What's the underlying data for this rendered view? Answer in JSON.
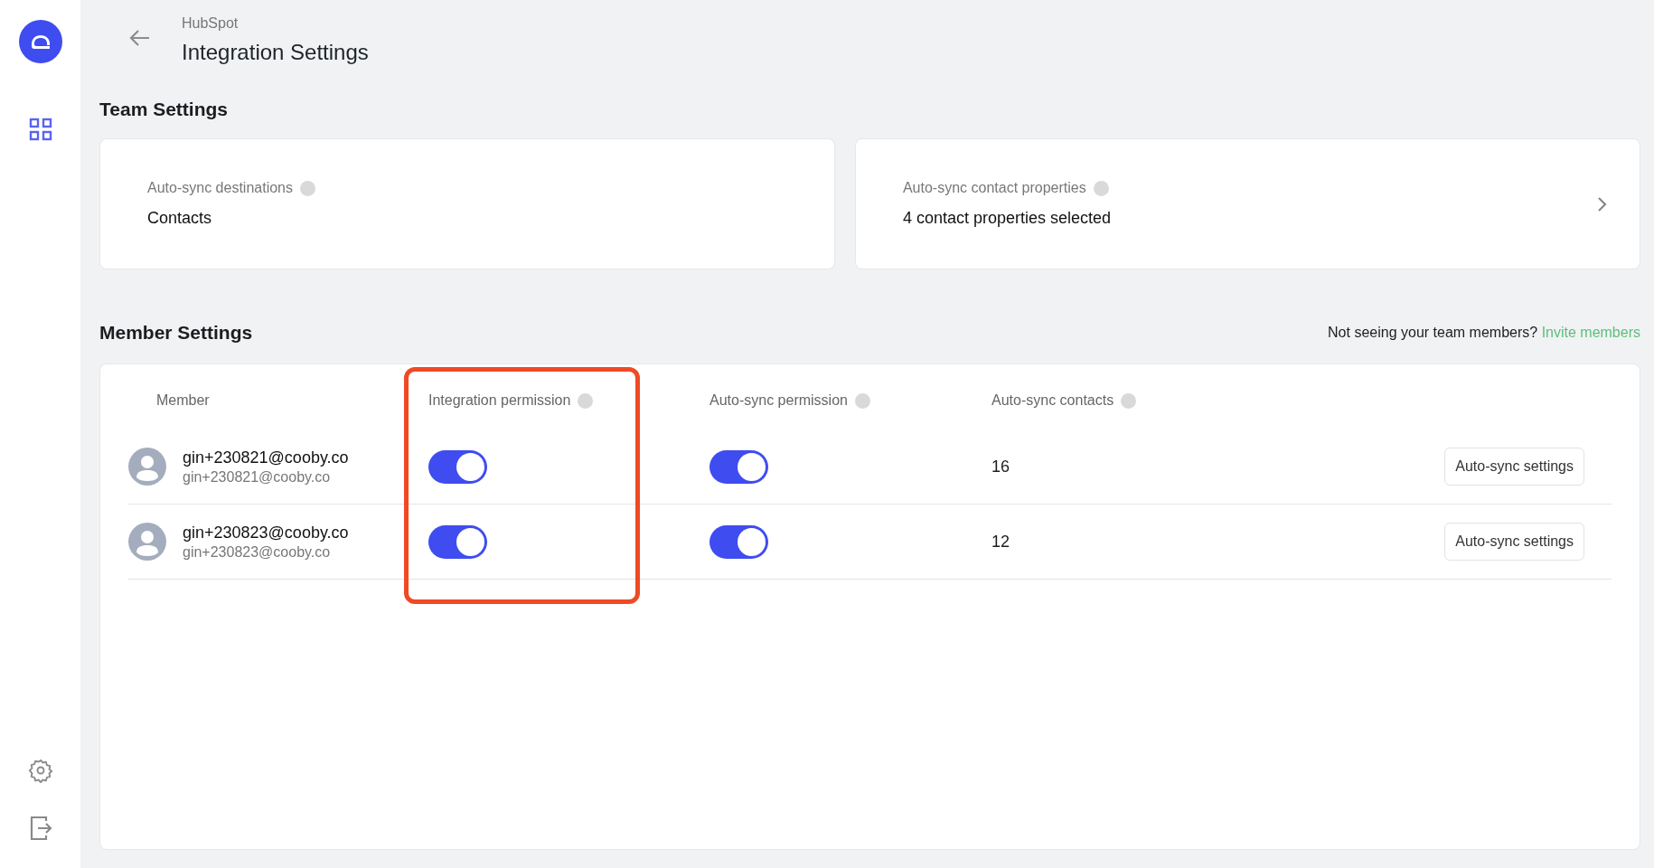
{
  "sidebar": {
    "items": [
      {
        "kind": "apps",
        "selected": true
      },
      {
        "kind": "settings",
        "selected": false
      },
      {
        "kind": "logout",
        "selected": false
      }
    ]
  },
  "header": {
    "breadcrumb": "HubSpot",
    "title": "Integration Settings"
  },
  "team_settings": {
    "heading": "Team Settings",
    "cards": [
      {
        "label": "Auto-sync destinations",
        "value": "Contacts",
        "has_chevron": false
      },
      {
        "label": "Auto-sync contact properties",
        "value": "4 contact properties selected",
        "has_chevron": true
      }
    ]
  },
  "member_settings": {
    "heading": "Member Settings",
    "hint": "Not seeing your team members?",
    "link": "Invite members",
    "columns": [
      {
        "label": "Member",
        "info": false,
        "highlighted": false
      },
      {
        "label": "Integration permission",
        "info": true,
        "highlighted": true
      },
      {
        "label": "Auto-sync permission",
        "info": true,
        "highlighted": false
      },
      {
        "label": "Auto-sync contacts",
        "info": true,
        "highlighted": false
      }
    ],
    "members": [
      {
        "name": "gin+230821@cooby.co",
        "email": "gin+230821@cooby.co",
        "integration_on": true,
        "autosync_on": true,
        "contacts": "16",
        "button": "Auto-sync settings"
      },
      {
        "name": "gin+230823@cooby.co",
        "email": "gin+230823@cooby.co",
        "integration_on": true,
        "autosync_on": true,
        "contacts": "12",
        "button": "Auto-sync settings"
      }
    ]
  }
}
